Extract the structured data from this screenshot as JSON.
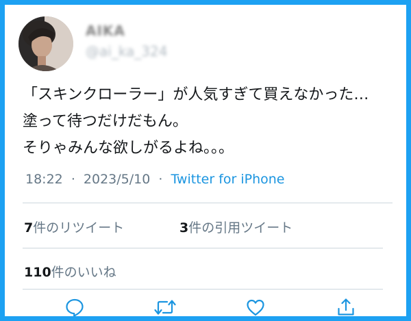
{
  "user": {
    "display_name": "AIKA",
    "handle": "@ai_ka_324"
  },
  "tweet": {
    "lines": [
      "「スキンクローラー」が人気すぎて買えなかった…",
      "塗って待つだけだもん。",
      "そりゃみんな欲しがるよね。。。"
    ],
    "time": "18:22",
    "date": "2023/5/10",
    "separator": "·",
    "source": "Twitter for iPhone"
  },
  "stats": {
    "retweets": {
      "count": "7",
      "label": "件のリツイート"
    },
    "quotes": {
      "count": "3",
      "label": "件の引用ツイート"
    },
    "likes": {
      "count": "110",
      "label": "件のいいね"
    }
  },
  "actions": [
    {
      "icon": "reply-icon"
    },
    {
      "icon": "retweet-icon"
    },
    {
      "icon": "like-icon"
    },
    {
      "icon": "share-icon"
    }
  ],
  "colors": {
    "frame": "#1da1f2",
    "link": "#1b95e0",
    "secondary_text": "#657786",
    "icon": "#1b95e0"
  }
}
